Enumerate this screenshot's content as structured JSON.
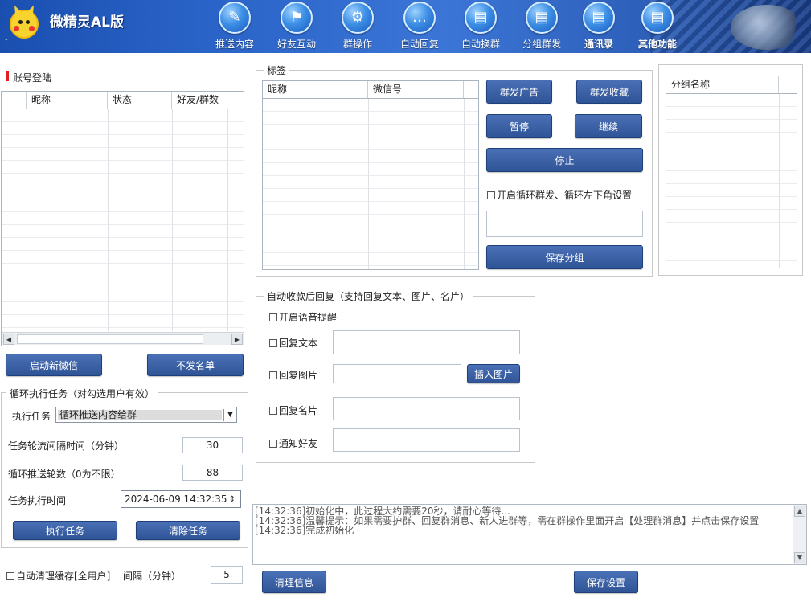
{
  "header": {
    "app_title": "微精灵AL版",
    "dash": "-",
    "nav": [
      {
        "label": "推送内容",
        "icon": "pen-icon",
        "glyph": "✎"
      },
      {
        "label": "好友互动",
        "icon": "flag-icon",
        "glyph": "⚑"
      },
      {
        "label": "群操作",
        "icon": "gear-icon",
        "glyph": "⚙"
      },
      {
        "label": "自动回复",
        "icon": "chat-bubble-icon",
        "glyph": "…"
      },
      {
        "label": "自动换群",
        "icon": "chat-bubble-icon",
        "glyph": "▤"
      },
      {
        "label": "分组群发",
        "icon": "chat-bubble-icon",
        "glyph": "▤"
      },
      {
        "label": "通讯录",
        "icon": "chat-bubble-icon",
        "glyph": "▤"
      },
      {
        "label": "其他功能",
        "icon": "chat-bubble-icon",
        "glyph": "▤"
      }
    ]
  },
  "account": {
    "title": "账号登陆",
    "columns": [
      "昵称",
      "状态",
      "好友/群数"
    ],
    "start_button": "启动新微信",
    "blacklist_button": "不发名单"
  },
  "loop_task": {
    "legend": "循环执行任务（对勾选用户有效）",
    "task_label": "执行任务",
    "task_value": "循环推送内容给群",
    "interval_label": "任务轮流间隔时间（分钟）",
    "interval_value": "30",
    "rounds_label": "循环推送轮数（0为不限）",
    "rounds_value": "88",
    "time_label": "任务执行时间",
    "time_value": "2024-06-09 14:32:35",
    "run_button": "执行任务",
    "clear_button": "清除任务"
  },
  "cache": {
    "checkbox_label": "自动清理缓存[全用户]",
    "interval_label": "间隔（分钟）",
    "interval_value": "5"
  },
  "tags": {
    "legend": "标签",
    "columns": [
      "昵称",
      "微信号"
    ],
    "group_ad": "群发广告",
    "group_fav": "群发收藏",
    "pause": "暂停",
    "resume": "继续",
    "stop": "停止",
    "loop_checkbox": "开启循环群发、循环左下角设置",
    "save_group": "保存分组"
  },
  "group_list": {
    "column": "分组名称"
  },
  "auto_reply": {
    "legend": "自动收款后回复（支持回复文本、图片、名片）",
    "voice": "开启语音提醒",
    "reply_text": "回复文本",
    "reply_image": "回复图片",
    "insert_image": "插入图片",
    "reply_card": "回复名片",
    "notify_friend": "通知好友"
  },
  "log": {
    "lines": [
      "[14:32:36]初始化中，此过程大约需要20秒，请耐心等待...",
      "[14:32:36]温馨提示：如果需要护群、回复群消息、新人进群等，需在群操作里面开启【处理群消息】并点击保存设置",
      "[14:32:36]完成初始化"
    ],
    "clear_button": "清理信息",
    "save_button": "保存设置"
  }
}
